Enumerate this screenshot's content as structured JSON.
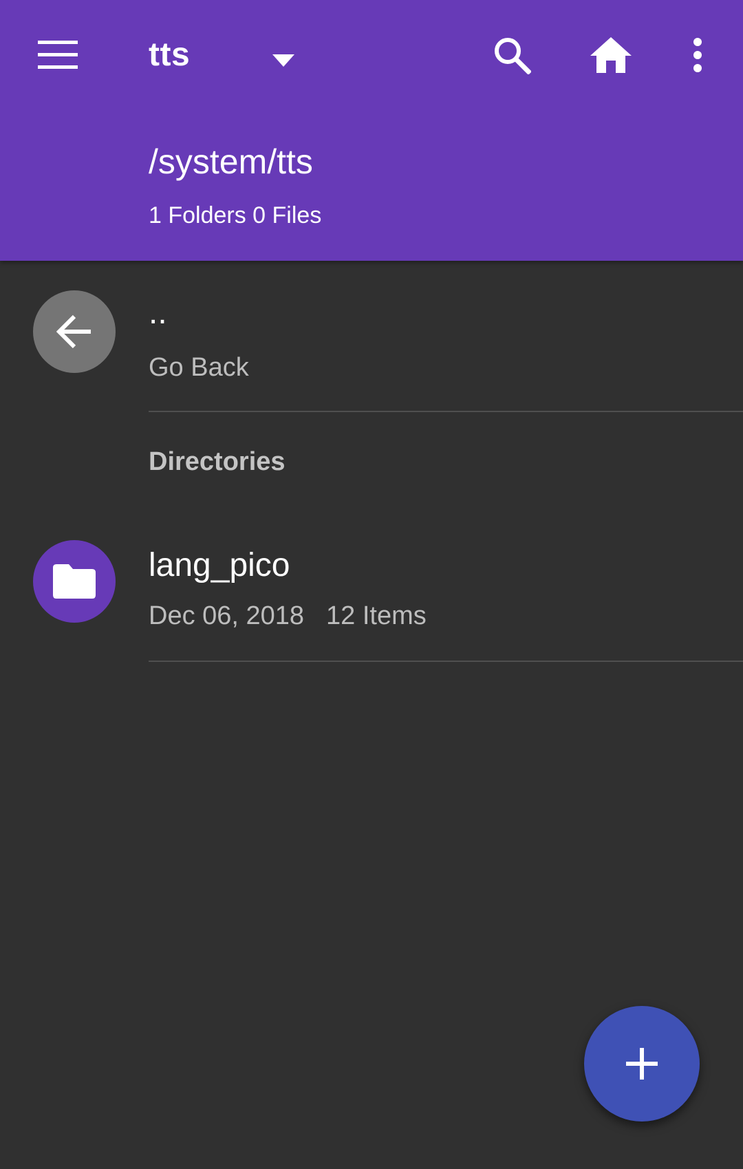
{
  "app_bar": {
    "title": "tts",
    "path": "/system/tts",
    "summary": "1 Folders 0 Files",
    "background_color": "#673AB7",
    "icons": [
      "menu-icon",
      "dropdown-arrow-icon",
      "search-icon",
      "home-icon",
      "more-vert-icon"
    ]
  },
  "back_item": {
    "title": "..",
    "subtitle": "Go Back",
    "icon": "arrow-back-icon",
    "avatar_color": "#757575"
  },
  "section": {
    "header": "Directories"
  },
  "items": [
    {
      "name": "lang_pico",
      "date": "Dec 06, 2018",
      "count": "12 Items",
      "icon": "folder-icon",
      "avatar_color": "#673AB7"
    }
  ],
  "fab": {
    "icon": "add-icon",
    "color": "#3F51B5"
  }
}
